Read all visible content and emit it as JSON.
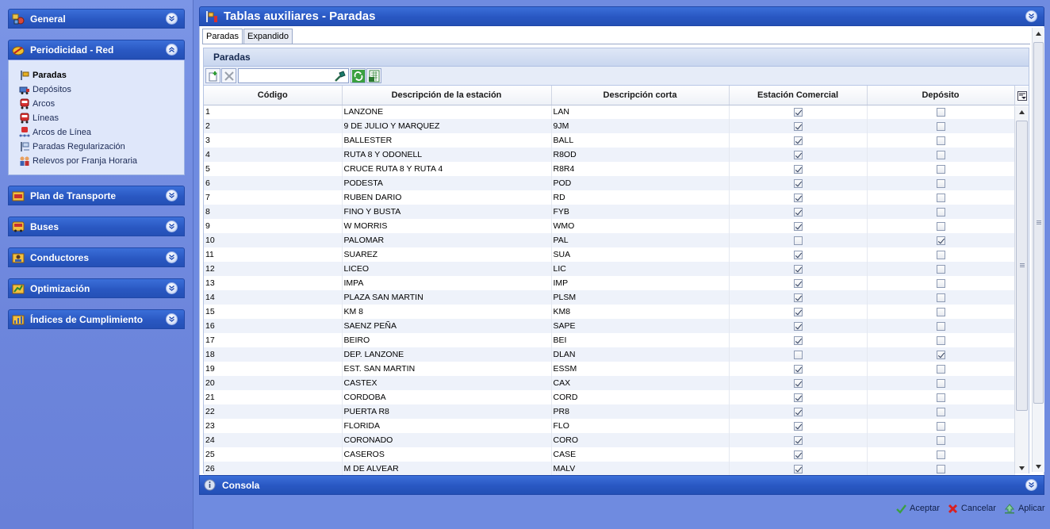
{
  "sidebar": {
    "panels": [
      {
        "label": "General",
        "icon": "general-icon",
        "expanded": false
      },
      {
        "label": "Periodicidad - Red",
        "icon": "periodicidad-icon",
        "expanded": true
      },
      {
        "label": "Plan de Transporte",
        "icon": "plan-icon",
        "expanded": false
      },
      {
        "label": "Buses",
        "icon": "bus-icon",
        "expanded": false
      },
      {
        "label": "Conductores",
        "icon": "conductores-icon",
        "expanded": false
      },
      {
        "label": "Optimización",
        "icon": "optimizacion-icon",
        "expanded": false
      },
      {
        "label": "Índices de Cumplimiento",
        "icon": "indices-icon",
        "expanded": false
      }
    ],
    "red_items": [
      {
        "label": "Paradas",
        "active": true
      },
      {
        "label": "Depósitos"
      },
      {
        "label": "Arcos"
      },
      {
        "label": "Líneas"
      },
      {
        "label": "Arcos de Línea"
      },
      {
        "label": "Paradas Regularización"
      },
      {
        "label": "Relevos por Franja Horaria"
      }
    ]
  },
  "main": {
    "title": "Tablas auxiliares - Paradas",
    "tabs": [
      {
        "label": "Paradas",
        "active": true
      },
      {
        "label": "Expandido"
      }
    ],
    "grid_title": "Paradas",
    "search": {
      "value": "",
      "placeholder": ""
    },
    "columns": [
      "Código",
      "Descripción de la estación",
      "Descripción corta",
      "Estación Comercial",
      "Depósito"
    ],
    "rows": [
      [
        "1",
        "LANZONE",
        "LAN",
        true,
        false
      ],
      [
        "2",
        "9 DE JULIO Y MARQUEZ",
        "9JM",
        true,
        false
      ],
      [
        "3",
        "BALLESTER",
        "BALL",
        true,
        false
      ],
      [
        "4",
        "RUTA 8 Y ODONELL",
        "R8OD",
        true,
        false
      ],
      [
        "5",
        "CRUCE RUTA 8 Y RUTA 4",
        "R8R4",
        true,
        false
      ],
      [
        "6",
        "PODESTA",
        "POD",
        true,
        false
      ],
      [
        "7",
        "RUBEN DARIO",
        "RD",
        true,
        false
      ],
      [
        "8",
        "FINO Y BUSTA",
        "FYB",
        true,
        false
      ],
      [
        "9",
        "W MORRIS",
        "WMO",
        true,
        false
      ],
      [
        "10",
        "PALOMAR",
        "PAL",
        false,
        true
      ],
      [
        "11",
        "SUAREZ",
        "SUA",
        true,
        false
      ],
      [
        "12",
        "LICEO",
        "LIC",
        true,
        false
      ],
      [
        "13",
        "IMPA",
        "IMP",
        true,
        false
      ],
      [
        "14",
        "PLAZA SAN MARTIN",
        "PLSM",
        true,
        false
      ],
      [
        "15",
        "KM 8",
        "KM8",
        true,
        false
      ],
      [
        "16",
        "SAENZ PEÑA",
        "SAPE",
        true,
        false
      ],
      [
        "17",
        "BEIRO",
        "BEI",
        true,
        false
      ],
      [
        "18",
        "DEP. LANZONE",
        "DLAN",
        false,
        true
      ],
      [
        "19",
        "EST. SAN MARTIN",
        "ESSM",
        true,
        false
      ],
      [
        "20",
        "CASTEX",
        "CAX",
        true,
        false
      ],
      [
        "21",
        "CORDOBA",
        "CORD",
        true,
        false
      ],
      [
        "22",
        "PUERTA R8",
        "PR8",
        true,
        false
      ],
      [
        "23",
        "FLORIDA",
        "FLO",
        true,
        false
      ],
      [
        "24",
        "CORONADO",
        "CORO",
        true,
        false
      ],
      [
        "25",
        "CASEROS",
        "CASE",
        true,
        false
      ],
      [
        "26",
        "M DE ALVEAR",
        "MALV",
        true,
        false
      ]
    ]
  },
  "console": {
    "label": "Consola"
  },
  "footer": {
    "accept_label": "Aceptar",
    "cancel_label": "Cancelar",
    "apply_label": "Aplicar"
  }
}
